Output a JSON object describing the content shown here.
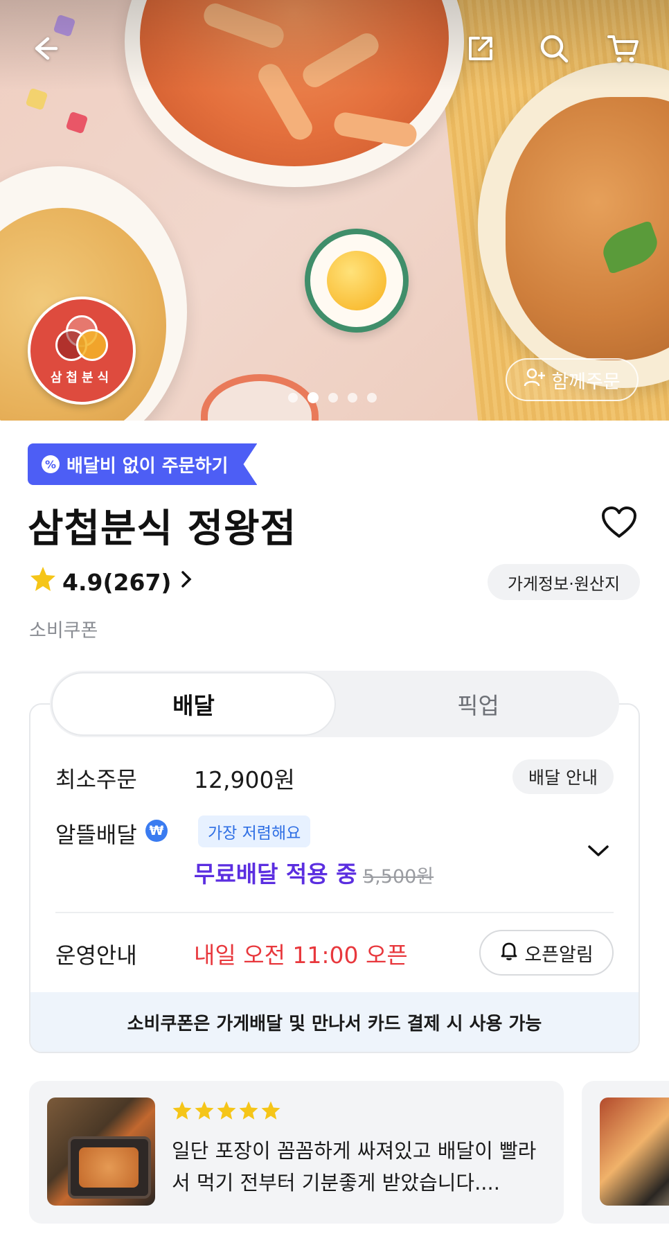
{
  "header": {
    "back_icon": "arrow-left-icon",
    "share_icon": "share-icon",
    "search_icon": "search-icon",
    "cart_icon": "cart-icon"
  },
  "hero": {
    "logo_text": "삼첩분식",
    "carousel": {
      "count": 5,
      "active_index": 1
    },
    "group_order_label": "함께주문"
  },
  "store": {
    "promo_tag": "배달비 없이 주문하기",
    "name": "삼첩분식 정왕점",
    "rating": "4.9",
    "review_count": "(267)",
    "info_button": "가게정보·원산지",
    "coupon_label": "소비쿠폰"
  },
  "tabs": [
    {
      "label": "배달",
      "active": true
    },
    {
      "label": "픽업",
      "active": false
    }
  ],
  "delivery": {
    "min_order_label": "최소주문",
    "min_order_value": "12,900원",
    "delivery_info_button": "배달 안내",
    "saver_label": "알뜰배달",
    "cheapest_badge": "가장 저렴해요",
    "free_delivery_text": "무료배달 적용 중",
    "original_fee": "5,500원",
    "hours_label": "운영안내",
    "open_time": "내일 오전 11:00 오픈",
    "alarm_button": "오픈알림",
    "coupon_notice": "소비쿠폰은 가게배달 및 만나서 카드 결제 시 사용 가능"
  },
  "review": {
    "stars": 5,
    "text": "일단 포장이 꼼꼼하게 싸져있고 배달이 빨라서 먹기 전부터 기분좋게 받았습니다...."
  },
  "colors": {
    "accent_blue": "#4d5ef5",
    "purple": "#5b2ee0",
    "red": "#e8383d",
    "star": "#f5c518",
    "logo_red": "#de4b3e"
  }
}
